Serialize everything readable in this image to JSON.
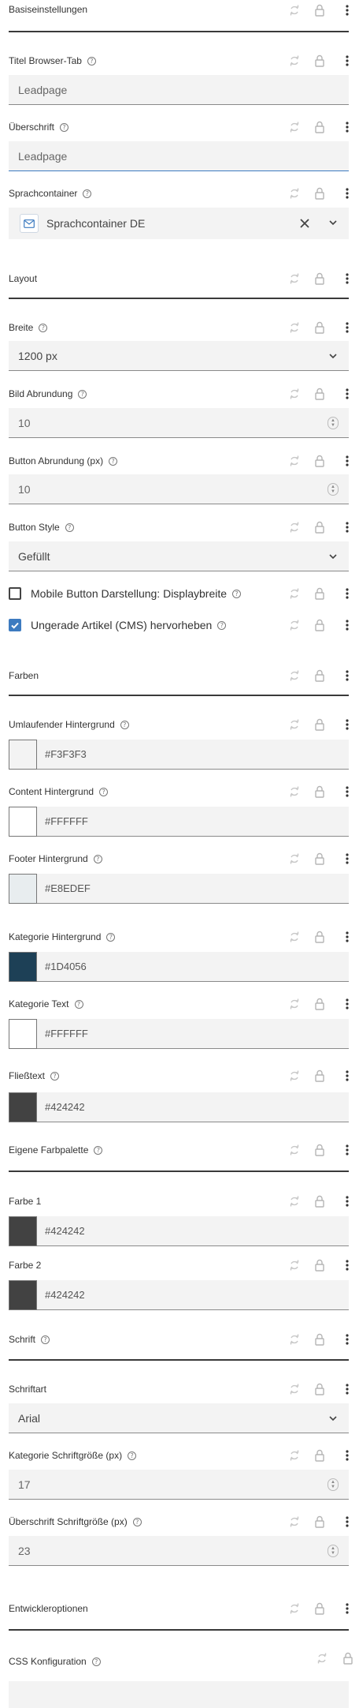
{
  "sections": {
    "basis": "Basiseinstellungen",
    "layout": "Layout",
    "farben": "Farben",
    "farbpalette": "Eigene Farbpalette",
    "schrift": "Schrift",
    "entwickler": "Entwickleroptionen"
  },
  "fields": {
    "titel_browser_tab": {
      "label": "Titel Browser-Tab",
      "value": "Leadpage"
    },
    "ueberschrift": {
      "label": "Überschrift",
      "value": "Leadpage"
    },
    "sprachcontainer": {
      "label": "Sprachcontainer",
      "value": "Sprachcontainer DE"
    },
    "breite": {
      "label": "Breite",
      "value": "1200 px"
    },
    "bild_abrundung": {
      "label": "Bild Abrundung",
      "value": "10"
    },
    "button_abrundung": {
      "label": "Button Abrundung (px)",
      "value": "10"
    },
    "button_style": {
      "label": "Button Style",
      "value": "Gefüllt"
    },
    "mobile_button": {
      "label": "Mobile Button Darstellung: Displaybreite",
      "checked": false
    },
    "ungerade_artikel": {
      "label": "Ungerade Artikel (CMS) hervorheben",
      "checked": true
    },
    "umlaufender_hintergrund": {
      "label": "Umlaufender Hintergrund",
      "value": "#F3F3F3",
      "color": "#F3F3F3"
    },
    "content_hintergrund": {
      "label": "Content Hintergrund",
      "value": "#FFFFFF",
      "color": "#FFFFFF"
    },
    "footer_hintergrund": {
      "label": "Footer Hintergrund",
      "value": "#E8EDEF",
      "color": "#E8EDEF"
    },
    "kategorie_hintergrund": {
      "label": "Kategorie Hintergrund",
      "value": "#1D4056",
      "color": "#1D4056"
    },
    "kategorie_text": {
      "label": "Kategorie Text",
      "value": "#FFFFFF",
      "color": "#FFFFFF"
    },
    "fliesstext": {
      "label": "Fließtext",
      "value": "#424242",
      "color": "#424242"
    },
    "farbe1": {
      "label": "Farbe 1",
      "value": "#424242",
      "color": "#424242"
    },
    "farbe2": {
      "label": "Farbe 2",
      "value": "#424242",
      "color": "#424242"
    },
    "schriftart": {
      "label": "Schriftart",
      "value": "Arial"
    },
    "kategorie_schriftgroesse": {
      "label": "Kategorie Schriftgröße (px)",
      "value": "17"
    },
    "ueberschrift_schriftgroesse": {
      "label": "Überschrift Schriftgröße (px)",
      "value": "23"
    },
    "css_konfiguration": {
      "label": "CSS Konfiguration"
    }
  },
  "icons": {
    "reset": "reset-icon",
    "lock": "lock-icon",
    "more": "more-vertical-icon",
    "info": "info-icon",
    "chevron": "chevron-down-icon",
    "clear": "close-icon",
    "mail": "mail-icon"
  },
  "colors": {
    "accent": "#3D7BC0",
    "section_line": "#3A3A3A",
    "input_bg": "#F3F3F3"
  }
}
